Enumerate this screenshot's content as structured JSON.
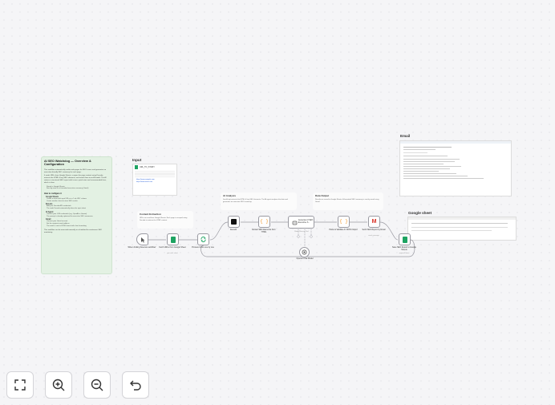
{
  "sticky_main": {
    "title": "AI SEO Watchdog — Overview & Configuration",
    "intro": "This workflow automatically audits web pages for SEO issues and generates an executive-friendly SEO summary for each page.",
    "steps": "It reads URLs from Google Sheets, scrapes the page content using Decodo, extracts the HTML & key SEO elements, and sends them to an AI model. The AI returns a structured SEO report with issues, quick wins and recommended fixes, which is then:",
    "bullets": [
      "Stored in Google Sheets",
      "Sent by email as a formatted executive summary (Gmail)"
    ],
    "howto": "How to configure it",
    "sections": [
      {
        "name": "Google Sheets",
        "items": [
          "Create a sheet with input URLs in a 'Link URL' column",
          "Create another sheet to store SEO results"
        ]
      },
      {
        "name": "Decodo",
        "items": [
          "Add your Decodo API credentials",
          "The node Decodo automatically takes the input sheet"
        ]
      },
      {
        "name": "AI Agent",
        "items": [
          "Connect your LLM credentials (e.g. OpenAI or Gemini)",
          "The prompt is already optimized for executive SEO summaries"
        ]
      },
      {
        "name": "Gmail",
        "items": [
          "Connect your Gmail account",
          "Set the recipient email address",
          "The email is sent in HTML format with clear formatting"
        ]
      }
    ],
    "footer": "This workflow can be executed manually or scheduled for continuous SEO monitoring."
  },
  "sections": {
    "input": "Input",
    "email": "Email",
    "google_sheet": "Google sheet"
  },
  "stickies": {
    "content_extraction": {
      "title": "Content Extraction",
      "text": "URLs are read from Google Sheets. Each page is scraped using Decodo to retrieve the HTML content."
    },
    "ai_analysis": {
      "title": "AI Analysis",
      "text": "JavaScript extracts the HTML & key SEO elements. The AI agent analyses the data and generates an executive SEO summary."
    },
    "data_output": {
      "title": "Data Output",
      "text": "Results are saved to Google Sheets. A formatted SEO summary is sent by email using Gmail."
    }
  },
  "nodes": {
    "trigger": {
      "label": "When clicking 'Execute workflow'"
    },
    "fetch": {
      "label": "Fetch URLs from Google Sheet",
      "sub": "get rows: sheet"
    },
    "loop": {
      "label": "Process URLs one by one"
    },
    "decodo": {
      "label": "Decodo"
    },
    "extract": {
      "label": "Extract SEO Elements from HTML"
    },
    "agent": {
      "label": "Generate AI SEO Executive S...",
      "sub": "Model   Memory   Tool"
    },
    "parse": {
      "label": "Parse & Validate AI JSON Output"
    },
    "gmail": {
      "label": "Send SEO Report by Email",
      "sub": "send: message"
    },
    "save": {
      "label": "Save SEO Report to Google Sheets",
      "sub": "append: sheet"
    },
    "model": {
      "label": "OpenAI Chat Model"
    }
  },
  "input_preview": {
    "header": "URL_TO_STUDY",
    "rows": [
      "https://www.example.com",
      "https://www.site-b.com"
    ]
  },
  "controls": {
    "fit": "fit-view",
    "zoom_in": "zoom-in",
    "zoom_out": "zoom-out",
    "undo": "undo"
  },
  "colors": {
    "sticky_green": "#e3f1e3",
    "sheets_green": "#1ea362",
    "gmail_red": "#d93025",
    "code_orange": "#f29d38",
    "wire": "#9a9aa2"
  }
}
